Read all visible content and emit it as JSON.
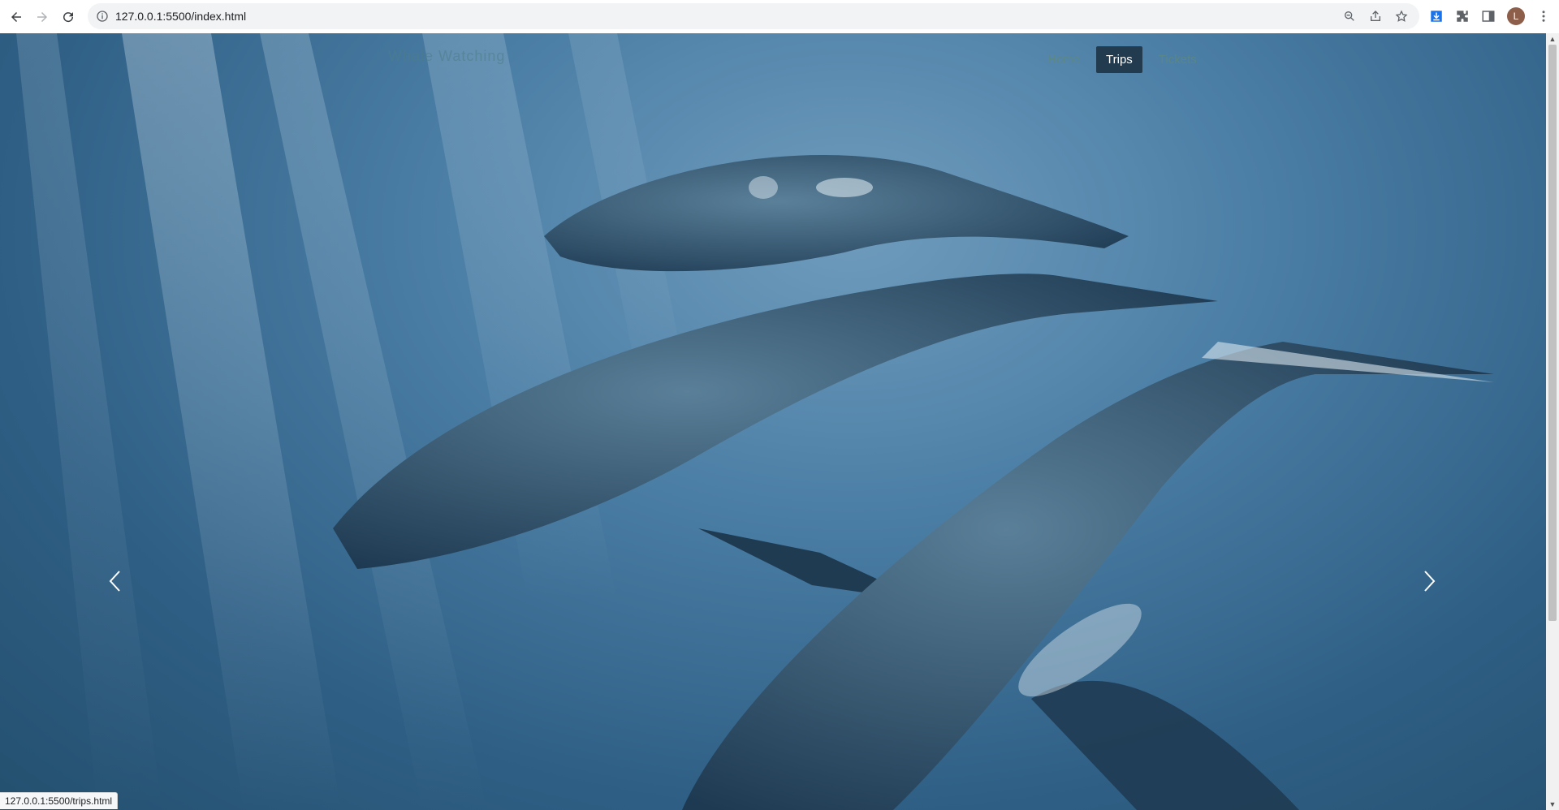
{
  "browser": {
    "url": "127.0.0.1:5500/index.html",
    "profile_initial": "L",
    "status_url": "127.0.0.1:5500/trips.html",
    "icons": [
      "back-icon",
      "forward-icon",
      "reload-icon",
      "info-icon",
      "zoom-icon",
      "share-icon",
      "star-icon",
      "download-icon",
      "extensions-icon",
      "sidepanel-icon",
      "menu-icon"
    ]
  },
  "site": {
    "brand": "Whale Watching",
    "nav": [
      {
        "label": "Home",
        "active": false
      },
      {
        "label": "Trips",
        "active": true
      },
      {
        "label": "Tickets",
        "active": false
      }
    ]
  },
  "colors": {
    "active_nav_bg": "#233b4f",
    "ocean_dark": "#24506f",
    "ocean_light": "#6f9cbd"
  }
}
